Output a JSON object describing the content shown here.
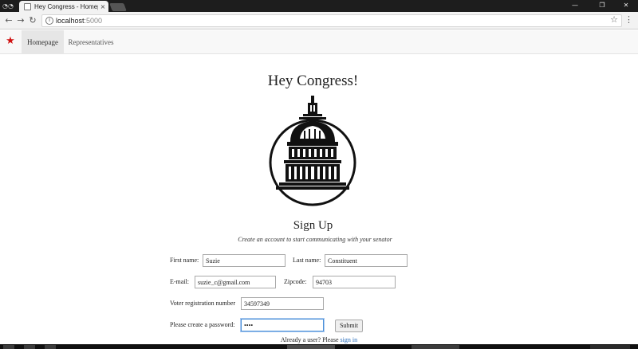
{
  "browser": {
    "tab_title": "Hey Congress - Homepage",
    "tab_close": "×",
    "url_host": "localhost",
    "url_port": ":5000",
    "info_glyph": "i",
    "icons": {
      "incognito": "incognito-icon",
      "back": "back-arrow-icon",
      "forward": "forward-arrow-icon",
      "reload": "reload-icon",
      "bookmark": "star-icon",
      "menu": "more-vertical-icon",
      "minimize": "minimize-icon",
      "maximize": "restore-icon",
      "close": "close-icon"
    }
  },
  "navbar": {
    "brand_icon": "star-icon",
    "brand_color": "#d01010",
    "links": [
      {
        "label": "Homepage",
        "active": true
      },
      {
        "label": "Representatives",
        "active": false
      }
    ]
  },
  "page": {
    "title": "Hey Congress!",
    "logo": "capitol-building-icon",
    "signup_title": "Sign Up",
    "subtitle": "Create an account to start communicating with your senator"
  },
  "form": {
    "first_name_label": "First name:",
    "first_name_value": "Suzie",
    "last_name_label": "Last name:",
    "last_name_value": "Constituent",
    "email_label": "E-mail:",
    "email_value": "suzie_c@gmail.com",
    "zipcode_label": "Zipcode:",
    "zipcode_value": "94703",
    "voter_label": "Voter registration number",
    "voter_value": "34597349",
    "password_label": "Please create a password:",
    "password_value": "••••",
    "submit_label": "Submit"
  },
  "footer": {
    "already_prefix": "Already a user? Please ",
    "signin_link": "sign in"
  }
}
